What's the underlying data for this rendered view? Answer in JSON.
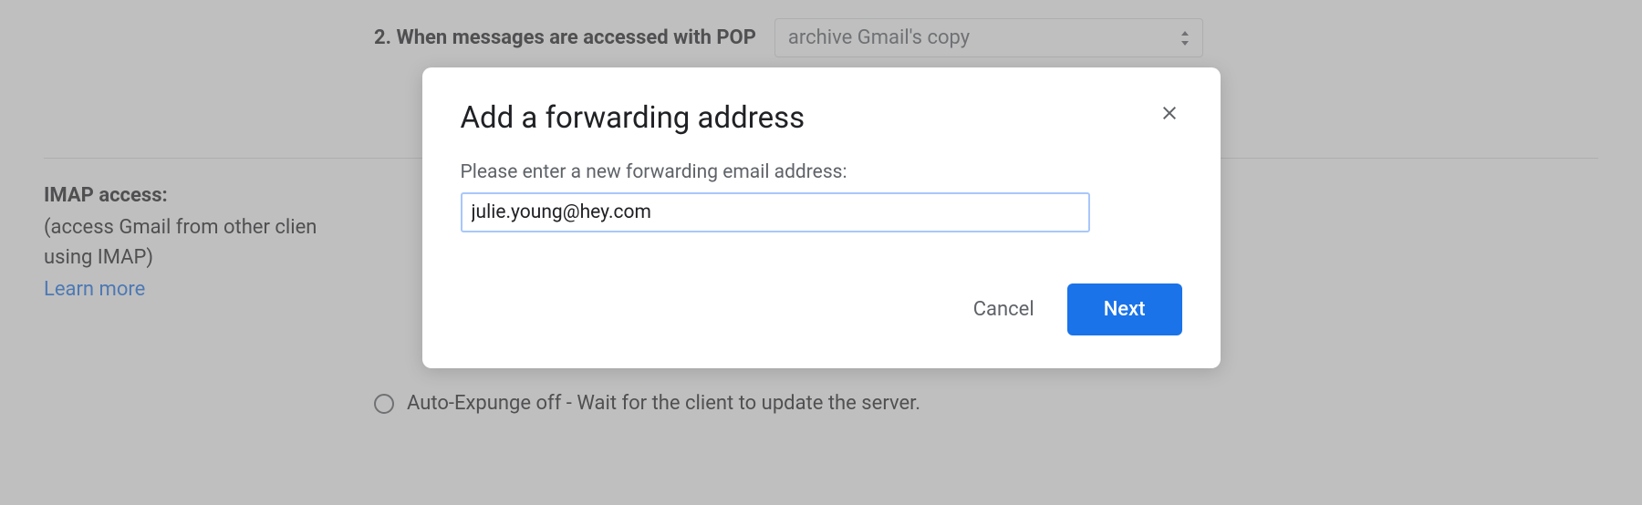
{
  "background": {
    "pop_label": "2. When messages are accessed with POP",
    "pop_select_value": "archive Gmail's copy",
    "imap_title": "IMAP access:",
    "imap_desc_line1": "(access Gmail from other clien",
    "imap_desc_line2": "using IMAP)",
    "learn_more": "Learn more",
    "auto_expunge_label": "Auto-Expunge off - Wait for the client to update the server."
  },
  "dialog": {
    "title": "Add a forwarding address",
    "prompt": "Please enter a new forwarding email address:",
    "email_value": "julie.young@hey.com",
    "cancel_label": "Cancel",
    "next_label": "Next"
  }
}
